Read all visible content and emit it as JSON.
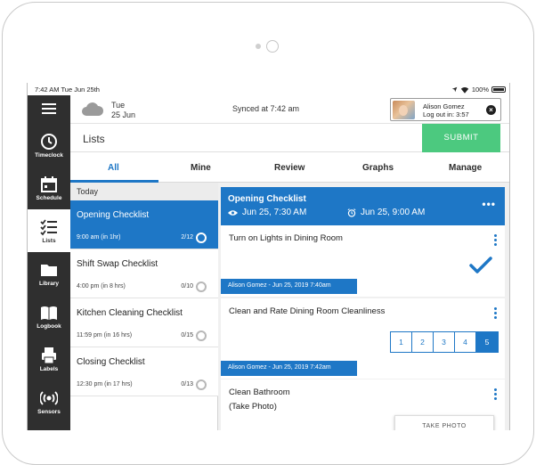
{
  "status_bar": {
    "time": "7:42 AM  Tue Jun 25th",
    "battery": "100%"
  },
  "sidebar": {
    "items": [
      {
        "label": "Timeclock",
        "icon": "clock-icon"
      },
      {
        "label": "Schedule",
        "icon": "calendar-icon"
      },
      {
        "label": "Lists",
        "icon": "checklist-icon",
        "active": true
      },
      {
        "label": "Library",
        "icon": "folder-icon"
      },
      {
        "label": "Logbook",
        "icon": "book-icon"
      },
      {
        "label": "Labels",
        "icon": "printer-icon"
      },
      {
        "label": "Sensors",
        "icon": "sensor-icon"
      }
    ]
  },
  "header": {
    "weather_icon": "cloud-icon",
    "day": "Tue",
    "date": "25 Jun",
    "sync_status": "Synced at 7:42 am",
    "user_name": "Alison Gomez",
    "logout_text": "Log out in: 3:57"
  },
  "title_bar": {
    "title": "Lists",
    "submit_label": "SUBMIT"
  },
  "tabs": [
    "All",
    "Mine",
    "Review",
    "Graphs",
    "Manage"
  ],
  "list": {
    "section": "Today",
    "items": [
      {
        "title": "Opening Checklist",
        "time": "9:00 am (in 1hr)",
        "count": "2/12",
        "active": true
      },
      {
        "title": "Shift Swap Checklist",
        "time": "4:00 pm (in 8 hrs)",
        "count": "0/10"
      },
      {
        "title": "Kitchen Cleaning Checklist",
        "time": "11:59 pm (in 16 hrs)",
        "count": "0/15"
      },
      {
        "title": "Closing Checklist",
        "time": "12:30 pm (in 17 hrs)",
        "count": "0/13"
      }
    ]
  },
  "detail": {
    "title": "Opening Checklist",
    "start": "Jun 25, 7:30 AM",
    "due": "Jun 25, 9:00 AM",
    "tasks": [
      {
        "title": "Turn on Lights in Dining Room",
        "completed_by": "Alison Gomez - Jun 25, 2019 7:40am"
      },
      {
        "title": "Clean and Rate Dining Room Cleanliness",
        "rating_options": [
          "1",
          "2",
          "3",
          "4",
          "5"
        ],
        "rating_selected": "5",
        "completed_by": "Alison Gomez - Jun 25, 2019 7:42am"
      },
      {
        "title": "Clean Bathroom",
        "subtitle": "(Take Photo)",
        "action_label": "TAKE PHOTO"
      }
    ]
  },
  "colors": {
    "accent": "#1e77c6",
    "submit": "#4cc97f",
    "sidebar": "#2f2f2f"
  }
}
